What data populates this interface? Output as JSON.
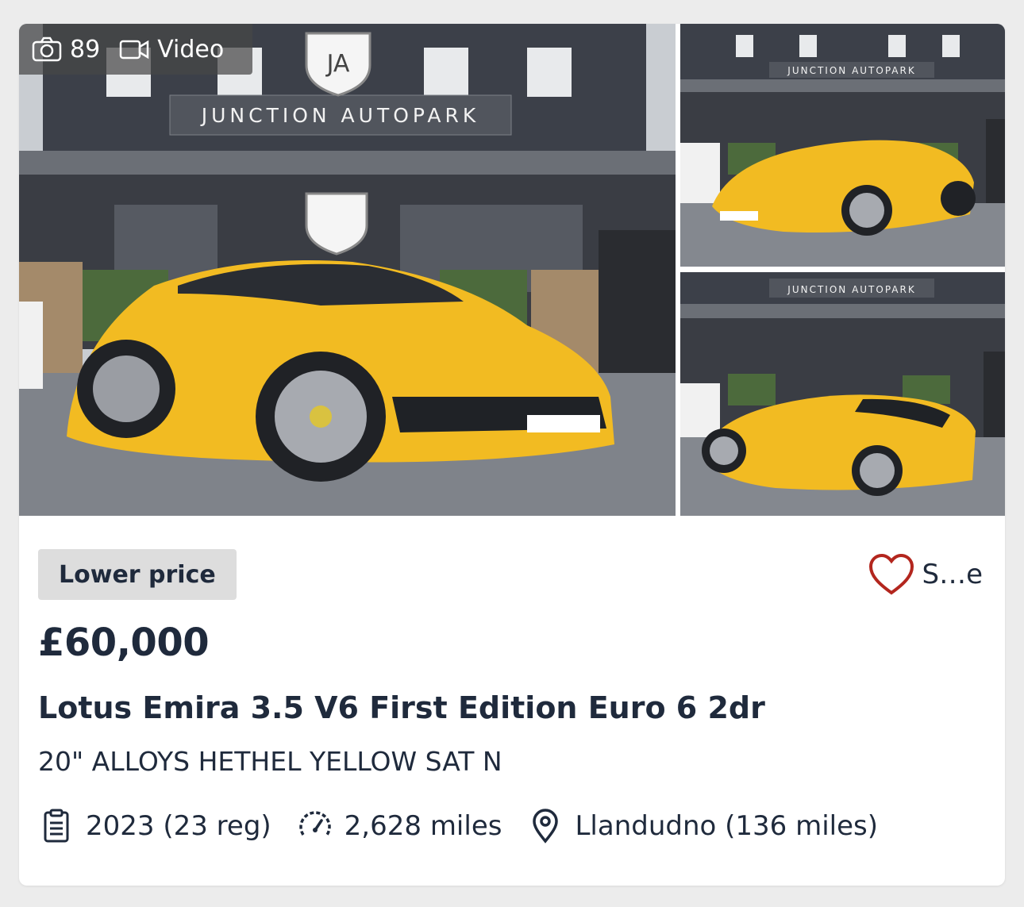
{
  "gallery": {
    "photo_count": "89",
    "video_label": "Video",
    "dealer_sign": "JUNCTION AUTOPARK",
    "dealer_logo": "JA",
    "car_color": "#f2bb22"
  },
  "listing": {
    "badge": "Lower price",
    "save_label": "S…e",
    "price": "£60,000",
    "title": "Lotus Emira 3.5 V6 First Edition Euro 6 2dr",
    "subtitle": "20\" ALLOYS HETHEL YELLOW SAT N",
    "specs": {
      "year": "2023 (23 reg)",
      "mileage": "2,628 miles",
      "location": "Llandudno (136 miles)"
    }
  },
  "icons": {
    "camera": "camera-icon",
    "video": "video-icon",
    "heart": "heart-icon",
    "year": "registration-doc-icon",
    "mileage": "speedometer-icon",
    "location": "map-pin-icon"
  },
  "colors": {
    "text": "#1f2a3c",
    "badge_bg": "#dddddd",
    "heart": "#b3261e",
    "card_bg": "#ffffff",
    "page_bg": "#ececec"
  }
}
